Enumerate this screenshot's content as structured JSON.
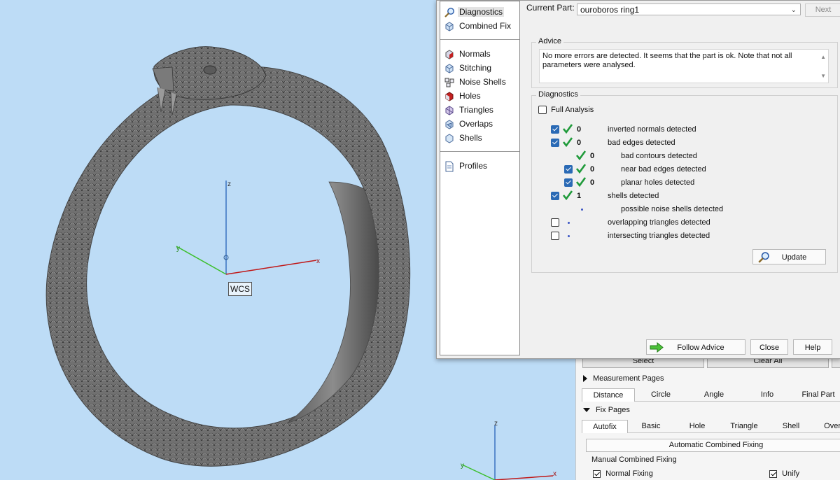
{
  "viewport": {
    "wcs_label": "WCS",
    "axis_x": "x",
    "axis_y": "y",
    "axis_z": "z",
    "small_axis_z": "z",
    "small_axis_y": "y",
    "small_axis_x": "x",
    "colors": {
      "background": "#bddcf6",
      "x_axis": "#c01818",
      "y_axis": "#3cbf2c",
      "z_axis": "#3a72c0",
      "model": "#6d6d6d"
    }
  },
  "nav": {
    "items": [
      {
        "label": "Diagnostics",
        "icon": "magnifier-icon"
      },
      {
        "label": "Combined Fix",
        "icon": "cube-icon"
      },
      {
        "label": "Normals",
        "icon": "normals-cube-icon"
      },
      {
        "label": "Stitching",
        "icon": "stitching-cube-icon"
      },
      {
        "label": "Noise Shells",
        "icon": "noise-shells-icon"
      },
      {
        "label": "Holes",
        "icon": "holes-cube-icon"
      },
      {
        "label": "Triangles",
        "icon": "triangles-icon"
      },
      {
        "label": "Overlaps",
        "icon": "overlaps-icon"
      },
      {
        "label": "Shells",
        "icon": "shells-icon"
      },
      {
        "label": "Profiles",
        "icon": "document-icon"
      }
    ]
  },
  "header": {
    "current_part_label": "Current Part:",
    "current_part_value": "ouroboros ring1",
    "next_label": "Next"
  },
  "advice": {
    "title": "Advice",
    "text": "No more errors are detected. It seems that the part is ok. Note that not all parameters were analysed."
  },
  "diagnostics": {
    "title": "Diagnostics",
    "full_analysis_label": "Full Analysis",
    "rows": [
      {
        "checked": true,
        "status": "ok",
        "count": "0",
        "text": "inverted normals detected",
        "level": 0
      },
      {
        "checked": true,
        "status": "ok",
        "count": "0",
        "text": "bad edges detected",
        "level": 0
      },
      {
        "checked": null,
        "status": "ok",
        "count": "0",
        "text": "bad contours detected",
        "level": 1
      },
      {
        "checked": true,
        "status": "ok",
        "count": "0",
        "text": "near bad edges detected",
        "level": 1
      },
      {
        "checked": true,
        "status": "ok",
        "count": "0",
        "text": "planar holes detected",
        "level": 1
      },
      {
        "checked": true,
        "status": "ok",
        "count": "1",
        "text": "shells detected",
        "level": 0
      },
      {
        "checked": null,
        "status": "none",
        "count": "",
        "text": "possible noise shells detected",
        "level": 1
      },
      {
        "checked": false,
        "status": "none",
        "count": "",
        "text": "overlapping triangles detected",
        "level": 0
      },
      {
        "checked": false,
        "status": "none",
        "count": "",
        "text": "intersecting triangles detected",
        "level": 0
      }
    ],
    "update_label": "Update"
  },
  "footer": {
    "follow_advice_label": "Follow Advice",
    "close_label": "Close",
    "help_label": "Help"
  },
  "bottom_panel": {
    "select_label": "Select",
    "clear_all_label": "Clear All",
    "measurement_pages_label": "Measurement Pages",
    "measurement_tabs": [
      "Distance",
      "Circle",
      "Angle",
      "Info",
      "Final Part"
    ],
    "fix_pages_label": "Fix Pages",
    "fix_tabs": [
      "Autofix",
      "Basic",
      "Hole",
      "Triangle",
      "Shell",
      "Over"
    ],
    "automatic_combined_fixing_label": "Automatic Combined Fixing",
    "manual_combined_fixing_label": "Manual Combined Fixing",
    "normal_fixing_label": "Normal Fixing",
    "unify_label": "Unify"
  }
}
